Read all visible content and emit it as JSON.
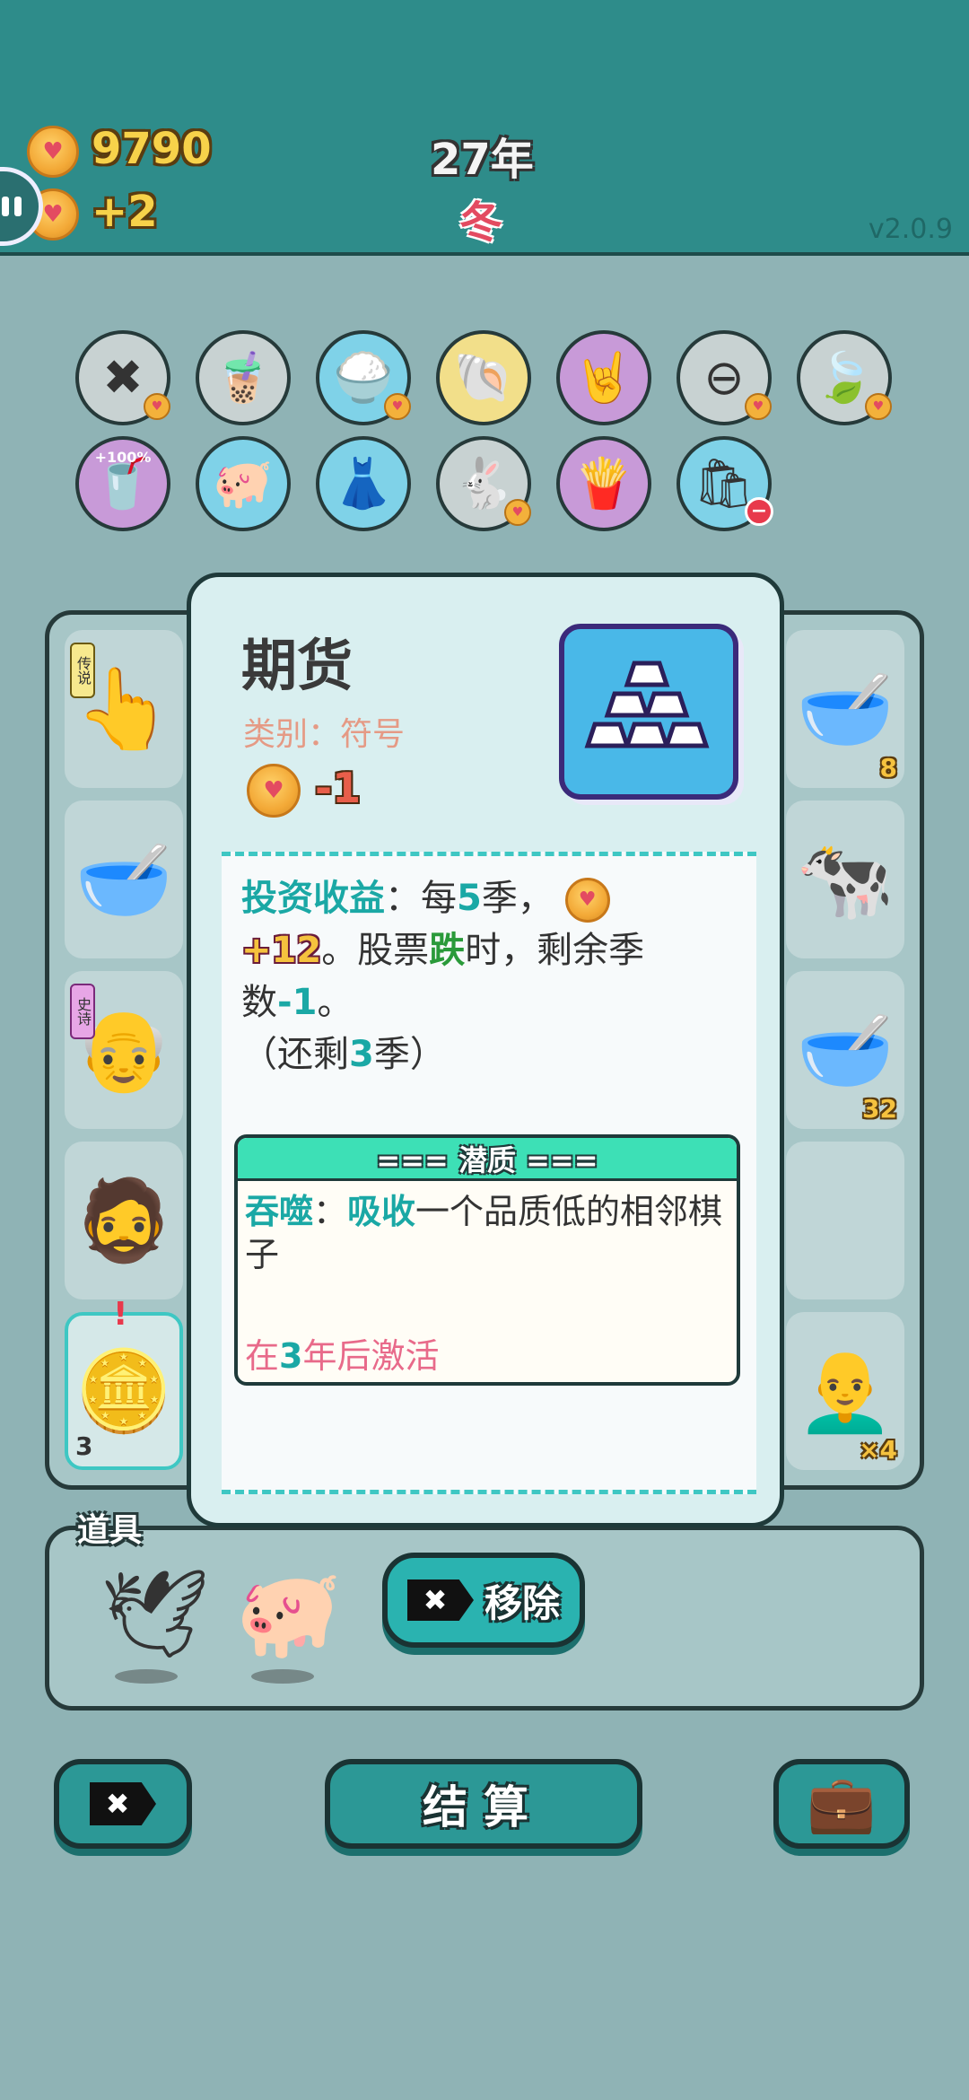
{
  "header": {
    "coins": "9790",
    "income": "+2",
    "year": "27年",
    "season": "冬",
    "version": "v2.0.9"
  },
  "relics": [
    {
      "icon": "remove-token-icon",
      "glyph": "✖",
      "bg": "#c8d2d2",
      "badge": "coin"
    },
    {
      "icon": "bubble-tea-icon",
      "glyph": "🧋",
      "bg": "#c8d2d2",
      "badge": ""
    },
    {
      "icon": "rice-bowl-icon",
      "glyph": "🍚",
      "bg": "#7fd2e8",
      "badge": "coin"
    },
    {
      "icon": "shell-icon",
      "glyph": "🐚",
      "bg": "#f2df8a",
      "badge": ""
    },
    {
      "icon": "rock-hand-icon",
      "glyph": "🤘",
      "bg": "#c89ad8",
      "badge": ""
    },
    {
      "icon": "minus-circle-icon",
      "glyph": "⊖",
      "bg": "#c8d2d2",
      "badge": "coin"
    },
    {
      "icon": "leaf-icon",
      "glyph": "🍃",
      "bg": "#c8d2d2",
      "badge": "coin"
    },
    {
      "icon": "tea-cup-plus-icon",
      "glyph": "🥤",
      "bg": "#c89ad8",
      "badge": "",
      "tag": "+100%"
    },
    {
      "icon": "piggy-bank-icon",
      "glyph": "🐖",
      "bg": "#7fd2e8",
      "badge": ""
    },
    {
      "icon": "skirt-icon",
      "glyph": "👗",
      "bg": "#7fd2e8",
      "badge": ""
    },
    {
      "icon": "rabbit-icon",
      "glyph": "🐇",
      "bg": "#c8d2d2",
      "badge": "coin"
    },
    {
      "icon": "fries-icon",
      "glyph": "🍟",
      "bg": "#c89ad8",
      "badge": ""
    },
    {
      "icon": "garbage-bag-icon",
      "glyph": "🛍",
      "bg": "#7fd2e8",
      "badge": "minus"
    }
  ],
  "board": {
    "left_cells": [
      {
        "icon": "pointing-hand-icon",
        "glyph": "👆",
        "rarity": "传说",
        "rarity_color": "yellow"
      },
      {
        "icon": "soup-bowl-icon",
        "glyph": "🥣"
      },
      {
        "icon": "old-man-face-icon",
        "glyph": "👴",
        "rarity": "史诗",
        "rarity_color": "purple"
      },
      {
        "icon": "bearded-man-face-icon",
        "glyph": "🧔"
      },
      {
        "icon": "gold-bars-icon",
        "glyph": "🪙",
        "count": "3",
        "alert": "!"
      }
    ],
    "right_cells": [
      {
        "icon": "soup-bowl-icon",
        "glyph": "🥣",
        "count": "8"
      },
      {
        "icon": "cow-icon",
        "glyph": "🐄"
      },
      {
        "icon": "soup-bowl-icon",
        "glyph": "🥣",
        "count": "32"
      },
      {
        "icon": "empty-cell",
        "glyph": ""
      },
      {
        "icon": "bald-man-face-icon",
        "glyph": "👨‍🦲",
        "count": "×4"
      }
    ]
  },
  "card": {
    "name": "期货",
    "category": "类别：符号",
    "cost": "-1",
    "desc": {
      "label": "投资收益",
      "colon": "：每",
      "num5": "5",
      "seasons_mid": "季，",
      "plus": "+12",
      "stock": "。股票",
      "fall": "跌",
      "rest": "时，剩余季数",
      "minus1": "-1",
      "end": "。",
      "remain_open": "（还剩",
      "remain_num": "3",
      "remain_close": "季）"
    },
    "potential": {
      "title": "=== 潜质 ===",
      "skill": "吞噬",
      "colon": "：",
      "absorb": "吸收",
      "body": "一个品质低的相邻棋子",
      "activate_prefix": "在",
      "activate_num": "3",
      "activate_suffix": "年后激活"
    }
  },
  "items": {
    "title": "道具",
    "list": [
      {
        "icon": "white-bird-icon",
        "glyph": "🕊"
      },
      {
        "icon": "piggy-bank-icon",
        "glyph": "🐖"
      }
    ],
    "remove_button": "移除"
  },
  "bottom": {
    "settle_button": "结算"
  },
  "colors": {
    "header_bg": "#2e8c8a",
    "page_bg": "#8fb3b5",
    "card_bg": "#d9eff0",
    "accent_teal": "#1aa8a5",
    "potential_header": "#3de0b6"
  }
}
